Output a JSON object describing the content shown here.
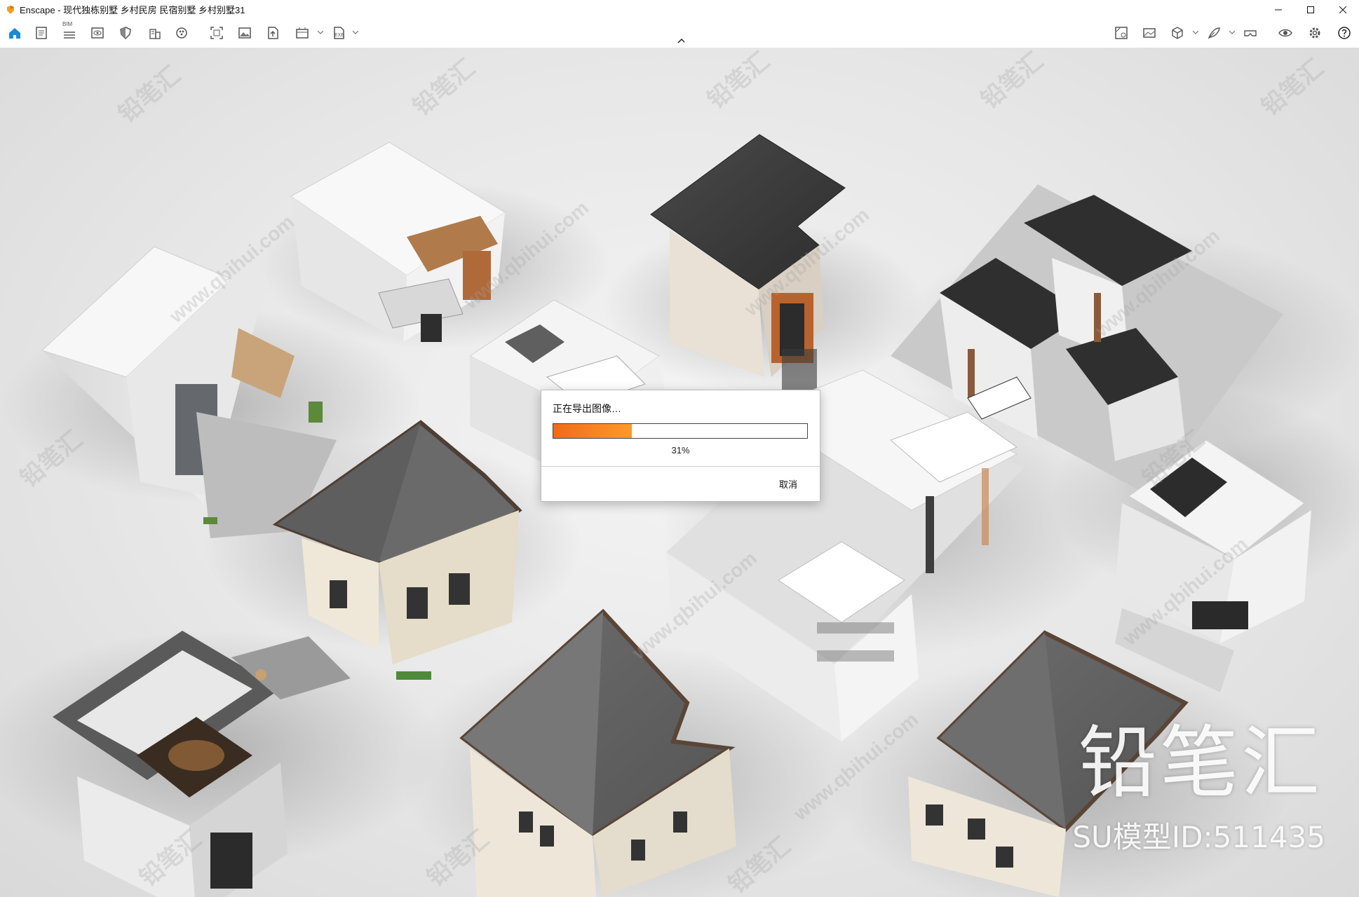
{
  "window": {
    "title": "Enscape - 现代独栋别墅 乡村民房 民宿别墅 乡村别墅31",
    "app_icon": "enscape-logo-icon"
  },
  "toolbar": {
    "bim_label": "BIM",
    "exe_label": "EXE",
    "left_icons": [
      "home-icon",
      "document-icon",
      "bim-list-icon",
      "view-eye-icon",
      "shield-icon",
      "building-icon",
      "material-icon",
      "screenshot-icon",
      "image-icon",
      "upload-icon",
      "render-batch-icon",
      "export-exe-icon"
    ],
    "right_icons": [
      "asset-library-icon",
      "panorama-icon",
      "cube-icon",
      "feather-icon",
      "vr-headset-icon",
      "visibility-icon",
      "settings-gear-icon",
      "help-icon"
    ]
  },
  "dialog": {
    "message": "正在导出图像…",
    "progress": 0.31,
    "progress_text": "31%",
    "cancel_label": "取消"
  },
  "watermark": {
    "brand": "铅笔汇",
    "model_id": "SU模型ID:511435",
    "repeat_cn": "铅笔汇",
    "repeat_url": "www.qbihui.com"
  },
  "colors": {
    "accent": "#1a8ad4",
    "progress": "#f07a1e"
  }
}
